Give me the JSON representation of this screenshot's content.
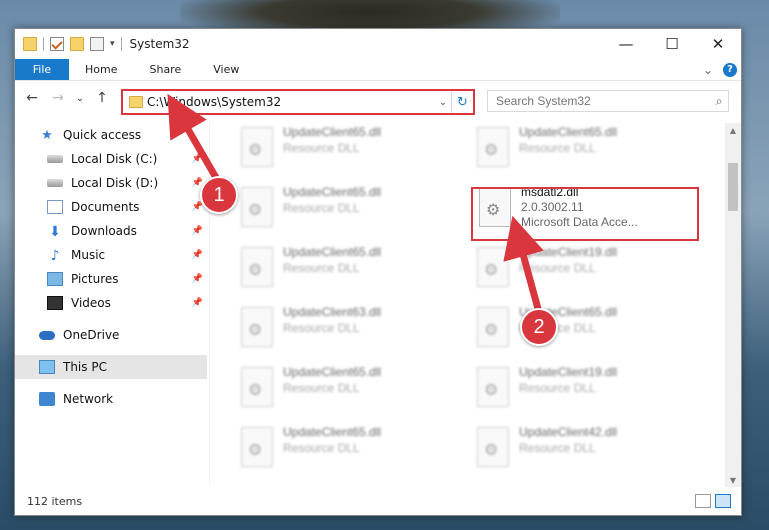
{
  "window": {
    "title": "System32",
    "controls": {
      "minimize": "—",
      "maximize": "☐",
      "close": "✕"
    }
  },
  "ribbon": {
    "tabs": [
      {
        "label": "File",
        "active": true
      },
      {
        "label": "Home"
      },
      {
        "label": "Share"
      },
      {
        "label": "View"
      }
    ],
    "expand": "⌄",
    "help": "?"
  },
  "nav": {
    "back": "←",
    "forward": "→",
    "recent": "⌄",
    "up": "↑",
    "address": "C:\\Windows\\System32",
    "address_dropdown": "⌄",
    "refresh": "↻",
    "search_placeholder": "Search System32",
    "search_icon": "⌕"
  },
  "sidebar": {
    "items": [
      {
        "label": "Quick access",
        "icon": "star-icon"
      },
      {
        "label": "Local Disk (C:)",
        "icon": "drive-icon",
        "pinned": true
      },
      {
        "label": "Local Disk (D:)",
        "icon": "drive-icon",
        "pinned": true
      },
      {
        "label": "Documents",
        "icon": "documents-icon",
        "pinned": true
      },
      {
        "label": "Downloads",
        "icon": "downloads-icon",
        "pinned": true
      },
      {
        "label": "Music",
        "icon": "music-icon",
        "pinned": true
      },
      {
        "label": "Pictures",
        "icon": "pictures-icon",
        "pinned": true
      },
      {
        "label": "Videos",
        "icon": "videos-icon",
        "pinned": true
      },
      {
        "label": "OneDrive",
        "icon": "onedrive-icon"
      },
      {
        "label": "This PC",
        "icon": "this-pc-icon",
        "selected": true
      },
      {
        "label": "Network",
        "icon": "network-icon"
      }
    ],
    "pin_glyph": "📌"
  },
  "files": {
    "left": [
      {
        "name": "UpdateClient65.dll",
        "desc": "Resource DLL"
      },
      {
        "name": "UpdateClient65.dll",
        "desc": "Resource DLL"
      },
      {
        "name": "UpdateClient65.dll",
        "desc": "Resource DLL"
      },
      {
        "name": "UpdateClient63.dll",
        "desc": "Resource DLL"
      },
      {
        "name": "UpdateClient65.dll",
        "desc": "Resource DLL"
      },
      {
        "name": "UpdateClient65.dll",
        "desc": "Resource DLL"
      }
    ],
    "right": [
      {
        "name": "UpdateClient65.dll",
        "desc": "Resource DLL"
      },
      {
        "name": "UpdateClient19.dll",
        "desc": "Resource DLL"
      },
      {
        "name": "UpdateClient65.dll",
        "desc": "Resource DLL"
      },
      {
        "name": "UpdateClient19.dll",
        "desc": "Resource DLL"
      },
      {
        "name": "UpdateClient42.dll",
        "desc": "Resource DLL"
      }
    ],
    "highlighted": {
      "name": "msdatl2.dll",
      "version": "2.0.3002.11",
      "company": "Microsoft Data Acce..."
    }
  },
  "annotations": {
    "step1": "1",
    "step2": "2",
    "accent": "#d9363e"
  },
  "status": {
    "count": "112 items"
  }
}
